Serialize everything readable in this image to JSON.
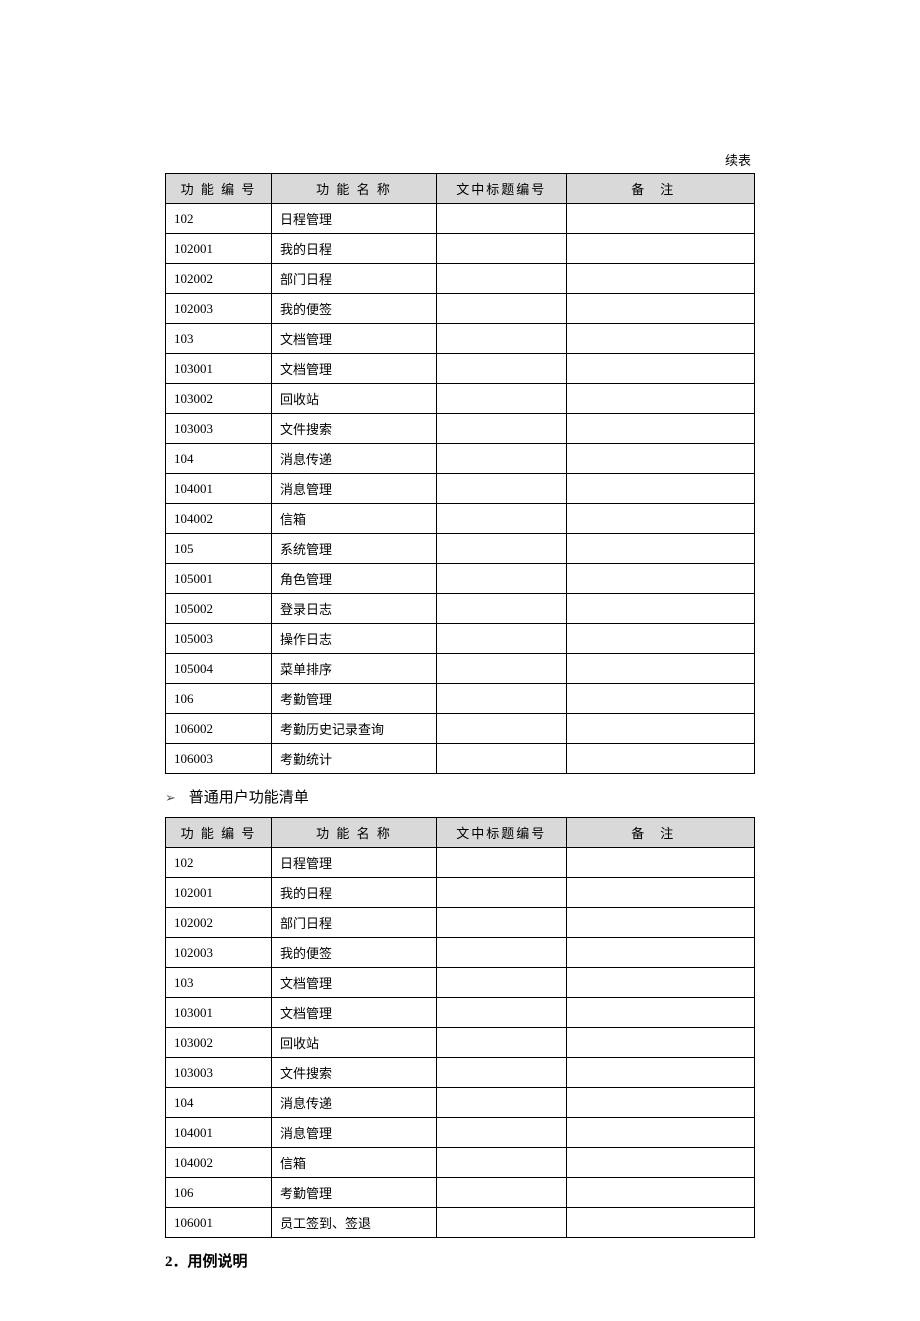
{
  "continuation_label": "续表",
  "headers": {
    "id": "功 能 编 号",
    "name": "功 能 名 称",
    "title": "文中标题编号",
    "remarks": "备注"
  },
  "table1": {
    "rows": [
      {
        "id": "102",
        "name": "日程管理",
        "title": "",
        "remarks": ""
      },
      {
        "id": "102001",
        "name": "我的日程",
        "title": "",
        "remarks": ""
      },
      {
        "id": "102002",
        "name": "部门日程",
        "title": "",
        "remarks": ""
      },
      {
        "id": "102003",
        "name": "我的便签",
        "title": "",
        "remarks": ""
      },
      {
        "id": "103",
        "name": "文档管理",
        "title": "",
        "remarks": ""
      },
      {
        "id": "103001",
        "name": "文档管理",
        "title": "",
        "remarks": ""
      },
      {
        "id": "103002",
        "name": "回收站",
        "title": "",
        "remarks": ""
      },
      {
        "id": "103003",
        "name": "文件搜索",
        "title": "",
        "remarks": ""
      },
      {
        "id": "104",
        "name": "消息传递",
        "title": "",
        "remarks": ""
      },
      {
        "id": "104001",
        "name": "消息管理",
        "title": "",
        "remarks": ""
      },
      {
        "id": "104002",
        "name": "信箱",
        "title": "",
        "remarks": ""
      },
      {
        "id": "105",
        "name": "系统管理",
        "title": "",
        "remarks": ""
      },
      {
        "id": "105001",
        "name": "角色管理",
        "title": "",
        "remarks": ""
      },
      {
        "id": "105002",
        "name": "登录日志",
        "title": "",
        "remarks": ""
      },
      {
        "id": "105003",
        "name": "操作日志",
        "title": "",
        "remarks": ""
      },
      {
        "id": "105004",
        "name": "菜单排序",
        "title": "",
        "remarks": ""
      },
      {
        "id": "106",
        "name": "考勤管理",
        "title": "",
        "remarks": ""
      },
      {
        "id": "106002",
        "name": "考勤历史记录查询",
        "title": "",
        "remarks": ""
      },
      {
        "id": "106003",
        "name": "考勤统计",
        "title": "",
        "remarks": ""
      }
    ]
  },
  "subheading": "普通用户功能清单",
  "table2": {
    "rows": [
      {
        "id": "102",
        "name": "日程管理",
        "title": "",
        "remarks": ""
      },
      {
        "id": "102001",
        "name": "我的日程",
        "title": "",
        "remarks": ""
      },
      {
        "id": "102002",
        "name": "部门日程",
        "title": "",
        "remarks": ""
      },
      {
        "id": "102003",
        "name": "我的便签",
        "title": "",
        "remarks": ""
      },
      {
        "id": "103",
        "name": "文档管理",
        "title": "",
        "remarks": ""
      },
      {
        "id": "103001",
        "name": "文档管理",
        "title": "",
        "remarks": ""
      },
      {
        "id": "103002",
        "name": "回收站",
        "title": "",
        "remarks": ""
      },
      {
        "id": "103003",
        "name": "文件搜索",
        "title": "",
        "remarks": ""
      },
      {
        "id": "104",
        "name": "消息传递",
        "title": "",
        "remarks": ""
      },
      {
        "id": "104001",
        "name": "消息管理",
        "title": "",
        "remarks": ""
      },
      {
        "id": "104002",
        "name": "信箱",
        "title": "",
        "remarks": ""
      },
      {
        "id": "106",
        "name": "考勤管理",
        "title": "",
        "remarks": ""
      },
      {
        "id": "106001",
        "name": "员工签到、签退",
        "title": "",
        "remarks": ""
      }
    ]
  },
  "section_heading": "2．用例说明"
}
